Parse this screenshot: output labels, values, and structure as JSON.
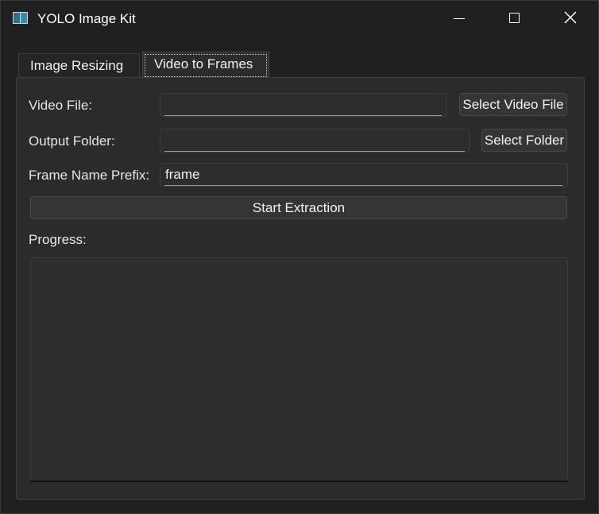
{
  "window": {
    "title": "YOLO Image Kit"
  },
  "tabs": [
    {
      "label": "Image Resizing",
      "active": false
    },
    {
      "label": "Video to Frames",
      "active": true
    }
  ],
  "form": {
    "video_file_label": "Video File:",
    "video_file_value": "",
    "select_video_button": "Select Video File",
    "output_folder_label": "Output Folder:",
    "output_folder_value": "",
    "select_folder_button": "Select Folder",
    "prefix_label": "Frame Name Prefix:",
    "prefix_value": "frame",
    "start_button": "Start Extraction",
    "progress_label": "Progress:",
    "progress_log": ""
  },
  "icons": {
    "app": "app-window-icon",
    "minimize": "minimize-icon",
    "maximize": "maximize-icon",
    "close": "close-icon"
  }
}
